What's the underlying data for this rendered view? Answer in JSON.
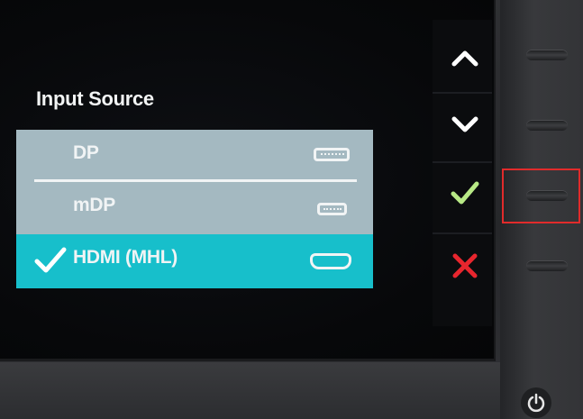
{
  "osd": {
    "title": "Input Source",
    "items": [
      {
        "label": "DP",
        "port_icon": "displayport-icon",
        "selected": false
      },
      {
        "label": "mDP",
        "port_icon": "mini-displayport-icon",
        "selected": false
      },
      {
        "label": "HDMI (MHL)",
        "port_icon": "hdmi-icon",
        "selected": true
      }
    ],
    "buttons": [
      {
        "icon": "chevron-up-icon",
        "color": "#ffffff"
      },
      {
        "icon": "chevron-down-icon",
        "color": "#ffffff"
      },
      {
        "icon": "check-icon",
        "color": "#b8e986"
      },
      {
        "icon": "close-icon",
        "color": "#e8262e"
      }
    ]
  },
  "colors": {
    "menu_item_bg": "#a4b9c1",
    "menu_selected_bg": "#17bfcb",
    "highlight_box": "#e12b2b"
  },
  "hardware_buttons": [
    "button-1",
    "button-2",
    "button-3",
    "button-4",
    "power-button"
  ],
  "highlighted_hardware_button": "button-3"
}
